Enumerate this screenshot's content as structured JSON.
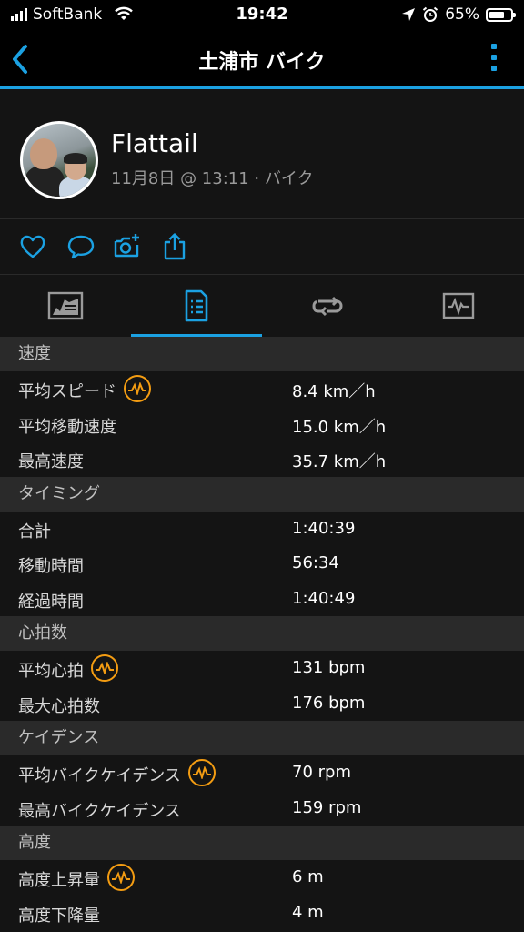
{
  "status_bar": {
    "carrier": "SoftBank",
    "time": "19:42",
    "battery": "65%"
  },
  "header": {
    "title": "土浦市 バイク"
  },
  "profile": {
    "name": "Flattail",
    "meta": "11月8日 @ 13:11 · バイク"
  },
  "accent_color": "#1ba1e2",
  "insight_color": "#f39c12",
  "sections": [
    {
      "title": "速度",
      "rows": [
        {
          "label": "平均スピード",
          "value": "8.4 km／h"
        },
        {
          "label": "平均移動速度",
          "value": "15.0 km／h"
        },
        {
          "label": "最高速度",
          "value": "35.7 km／h"
        }
      ]
    },
    {
      "title": "タイミング",
      "rows": [
        {
          "label": "合計",
          "value": "1:40:39"
        },
        {
          "label": "移動時間",
          "value": "56:34"
        },
        {
          "label": "経過時間",
          "value": "1:40:49"
        }
      ]
    },
    {
      "title": "心拍数",
      "rows": [
        {
          "label": "平均心拍",
          "value": "131 bpm"
        },
        {
          "label": "最大心拍数",
          "value": "176 bpm"
        }
      ]
    },
    {
      "title": "ケイデンス",
      "rows": [
        {
          "label": "平均バイクケイデンス",
          "value": "70 rpm"
        },
        {
          "label": "最高バイクケイデンス",
          "value": "159 rpm"
        }
      ]
    },
    {
      "title": "高度",
      "rows": [
        {
          "label": "高度上昇量",
          "value": "6 m"
        },
        {
          "label": "高度下降量",
          "value": "4 m"
        }
      ]
    }
  ]
}
